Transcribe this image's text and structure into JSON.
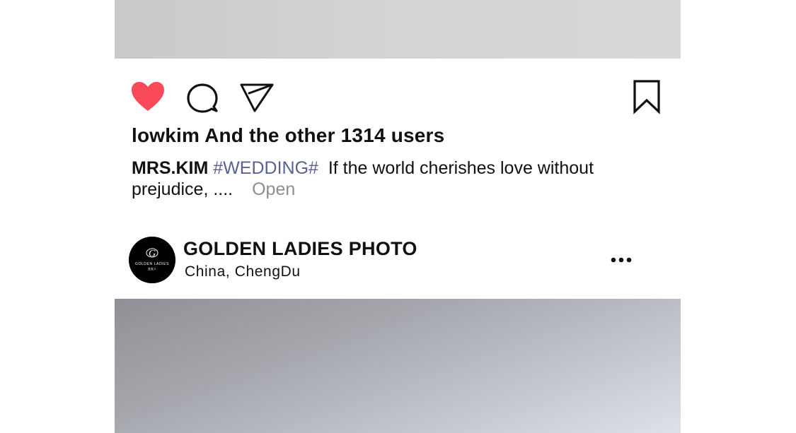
{
  "post_prev": {
    "likes_username": "lowkim",
    "likes_text": "And the other 1314 users",
    "caption_author": "MRS.KIM",
    "caption_hashtag": "#WEDDING#",
    "caption_text": "If the world cherishes love without prejudice, ....",
    "caption_more": "Open",
    "like_icon": "heart-filled-icon",
    "comment_icon": "speech-bubble-icon",
    "share_icon": "paper-plane-icon",
    "save_icon": "bookmark-icon",
    "like_color": "#fa4a5a"
  },
  "post_next": {
    "account_name": "GOLDEN LADIES PHOTO",
    "location": "China, ChengDu",
    "avatar_logo_text": "GOLDEN LADIES",
    "avatar_logo_subtext": "金女人",
    "more_icon": "three-dots-icon"
  }
}
